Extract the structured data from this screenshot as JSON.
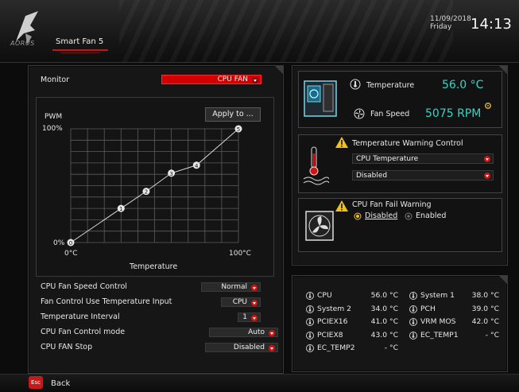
{
  "header": {
    "brand": "AORUS",
    "tab": "Smart Fan 5",
    "date": "11/09/2018",
    "day": "Friday",
    "time": "14:13"
  },
  "left": {
    "monitor_label": "Monitor",
    "monitor_value": "CPU FAN",
    "graph": {
      "apply_label": "Apply to ...",
      "y_title": "PWM",
      "y_max": "100%",
      "y_min": "0%",
      "x_min": "0°C",
      "x_max": "100°C",
      "x_title": "Temperature",
      "points": [
        {
          "label": "0",
          "temp": 0,
          "pwm": 0
        },
        {
          "label": "1",
          "temp": 30,
          "pwm": 30
        },
        {
          "label": "2",
          "temp": 45,
          "pwm": 45
        },
        {
          "label": "3",
          "temp": 60,
          "pwm": 61
        },
        {
          "label": "4",
          "temp": 75,
          "pwm": 68
        },
        {
          "label": "5",
          "temp": 100,
          "pwm": 100
        }
      ]
    },
    "settings": [
      {
        "label": "CPU Fan Speed Control",
        "value": "Normal"
      },
      {
        "label": "Fan Control Use Temperature Input",
        "value": "CPU"
      },
      {
        "label": "Temperature Interval",
        "value": "1"
      },
      {
        "label": "CPU Fan Control mode",
        "value": "Auto"
      },
      {
        "label": "CPU FAN Stop",
        "value": "Disabled"
      }
    ]
  },
  "right": {
    "temperature_label": "Temperature",
    "temperature_value": "56.0 °C",
    "fan_label": "Fan Speed",
    "fan_value": "5075 RPM",
    "warn_title": "Temperature Warning Control",
    "warn_source": "CPU Temperature",
    "warn_value": "Disabled",
    "fail_title": "CPU Fan Fail Warning",
    "fail_opt1": "Disabled",
    "fail_opt2": "Enabled",
    "sensors_left": [
      {
        "name": "CPU",
        "value": "56.0 °C"
      },
      {
        "name": "System 2",
        "value": "34.0 °C"
      },
      {
        "name": "PCIEX16",
        "value": "41.0 °C"
      },
      {
        "name": "PCIEX8",
        "value": "43.0 °C"
      },
      {
        "name": "EC_TEMP2",
        "value": "- °C"
      }
    ],
    "sensors_right": [
      {
        "name": "System 1",
        "value": "38.0 °C"
      },
      {
        "name": "PCH",
        "value": "39.0 °C"
      },
      {
        "name": "VRM MOS",
        "value": "42.0 °C"
      },
      {
        "name": "EC_TEMP1",
        "value": "- °C"
      }
    ]
  },
  "footer": {
    "esc": "Esc",
    "back": "Back"
  },
  "colors": {
    "accent_red": "#d40000",
    "value_cyan": "#36d6c6"
  }
}
